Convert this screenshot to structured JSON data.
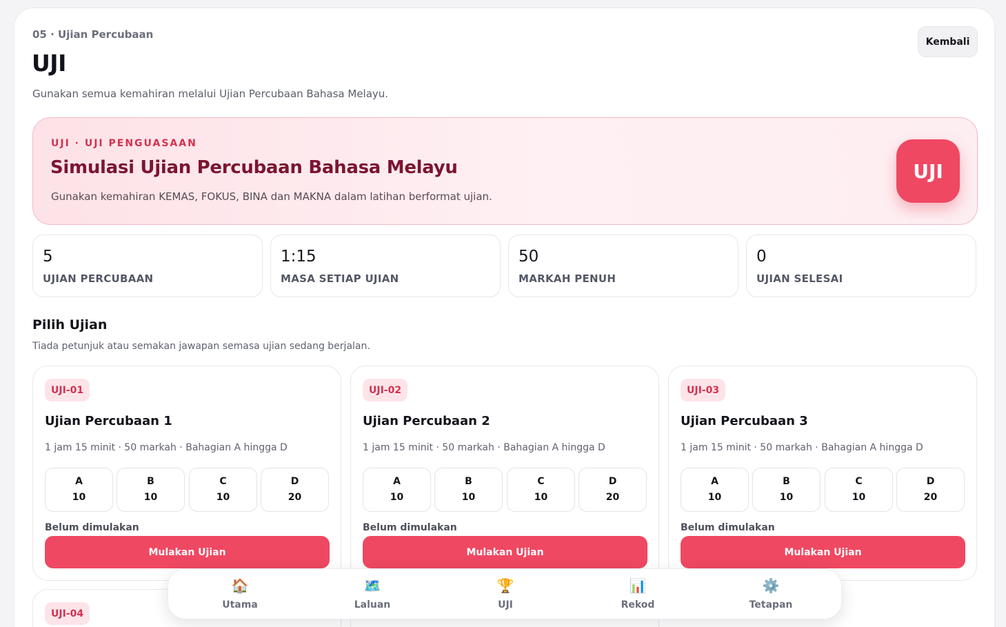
{
  "header": {
    "eyebrow": "05 · Ujian Percubaan",
    "title": "UJI",
    "subtitle": "Gunakan semua kemahiran melalui Ujian Percubaan Bahasa Melayu.",
    "back_label": "Kembali"
  },
  "hero": {
    "kicker": "UJI · UJI PENGUASAAN",
    "title": "Simulasi Ujian Percubaan Bahasa Melayu",
    "description": "Gunakan kemahiran KEMAS, FOKUS, BINA dan MAKNA dalam latihan berformat ujian.",
    "badge": "UJI"
  },
  "stats": [
    {
      "value": "5",
      "label": "UJIAN PERCUBAAN"
    },
    {
      "value": "1:15",
      "label": "MASA SETIAP UJIAN"
    },
    {
      "value": "50",
      "label": "MARKAH PENUH"
    },
    {
      "value": "0",
      "label": "UJIAN SELESAI"
    }
  ],
  "section": {
    "title": "Pilih Ujian",
    "subtitle": "Tiada petunjuk atau semakan jawapan semasa ujian sedang berjalan."
  },
  "exams": [
    {
      "code": "UJI-01",
      "title": "Ujian Percubaan 1",
      "meta": "1 jam 15 minit · 50 markah · Bahagian A hingga D",
      "parts": [
        {
          "letter": "A",
          "count": "10"
        },
        {
          "letter": "B",
          "count": "10"
        },
        {
          "letter": "C",
          "count": "10"
        },
        {
          "letter": "D",
          "count": "20"
        }
      ],
      "status": "Belum dimulakan",
      "button": "Mulakan Ujian"
    },
    {
      "code": "UJI-02",
      "title": "Ujian Percubaan 2",
      "meta": "1 jam 15 minit · 50 markah · Bahagian A hingga D",
      "parts": [
        {
          "letter": "A",
          "count": "10"
        },
        {
          "letter": "B",
          "count": "10"
        },
        {
          "letter": "C",
          "count": "10"
        },
        {
          "letter": "D",
          "count": "20"
        }
      ],
      "status": "Belum dimulakan",
      "button": "Mulakan Ujian"
    },
    {
      "code": "UJI-03",
      "title": "Ujian Percubaan 3",
      "meta": "1 jam 15 minit · 50 markah · Bahagian A hingga D",
      "parts": [
        {
          "letter": "A",
          "count": "10"
        },
        {
          "letter": "B",
          "count": "10"
        },
        {
          "letter": "C",
          "count": "10"
        },
        {
          "letter": "D",
          "count": "20"
        }
      ],
      "status": "Belum dimulakan",
      "button": "Mulakan Ujian"
    },
    {
      "code": "UJI-04"
    }
  ],
  "nav": [
    {
      "label": "Utama",
      "icon": "🏠",
      "icon_name": "home-icon"
    },
    {
      "label": "Laluan",
      "icon": "🗺️",
      "icon_name": "map-icon"
    },
    {
      "label": "UJI",
      "icon": "🏆",
      "icon_name": "trophy-icon"
    },
    {
      "label": "Rekod",
      "icon": "📊",
      "icon_name": "bar-chart-icon"
    },
    {
      "label": "Tetapan",
      "icon": "⚙️",
      "icon_name": "gear-icon"
    }
  ],
  "colors": {
    "accent": "#ef4862",
    "accent_dark": "#7b1530",
    "accent_soft": "#fde4e9"
  }
}
